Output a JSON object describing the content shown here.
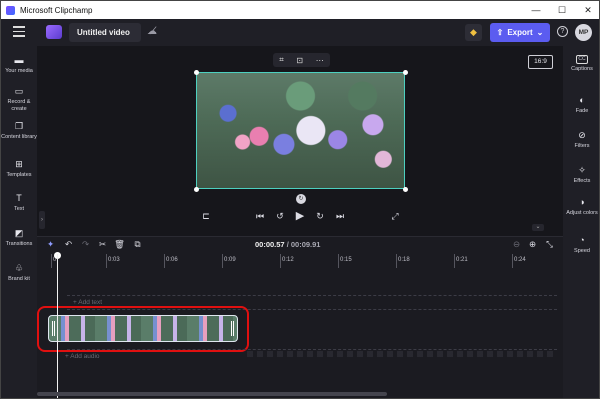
{
  "window": {
    "title": "Microsoft Clipchamp",
    "minimize": "—",
    "maximize": "☐",
    "close": "✕"
  },
  "header": {
    "project_title": "Untitled video",
    "export_label": "Export",
    "avatar_initials": "MP"
  },
  "left_sidebar": {
    "items": [
      {
        "label": "Your media",
        "icon": "folder-icon"
      },
      {
        "label": "Record & create",
        "icon": "camera-icon"
      },
      {
        "label": "Content library",
        "icon": "library-icon"
      },
      {
        "label": "Templates",
        "icon": "templates-icon"
      },
      {
        "label": "Text",
        "icon": "text-icon"
      },
      {
        "label": "Transitions",
        "icon": "transitions-icon"
      },
      {
        "label": "Brand kit",
        "icon": "brand-kit-icon"
      }
    ]
  },
  "right_sidebar": {
    "items": [
      {
        "label": "Captions",
        "icon": "captions-icon"
      },
      {
        "label": "Fade",
        "icon": "fade-icon"
      },
      {
        "label": "Filters",
        "icon": "filters-icon"
      },
      {
        "label": "Effects",
        "icon": "effects-icon"
      },
      {
        "label": "Adjust colors",
        "icon": "adjust-colors-icon"
      },
      {
        "label": "Speed",
        "icon": "speed-icon"
      }
    ]
  },
  "preview": {
    "aspect_ratio": "16:9"
  },
  "timeline": {
    "current_time": "00:00.57",
    "total_time": "/ 00:09.91",
    "ruler_labels": [
      "0",
      "0:03",
      "0:06",
      "0:09",
      "0:12",
      "0:15",
      "0:18",
      "0:21",
      "0:24"
    ],
    "add_text_label": "+ Add text",
    "add_audio_label": "+ Add audio"
  },
  "colors": {
    "accent": "#5b5cf0",
    "highlight": "#e01010",
    "clip_border": "#dfe7ef"
  }
}
